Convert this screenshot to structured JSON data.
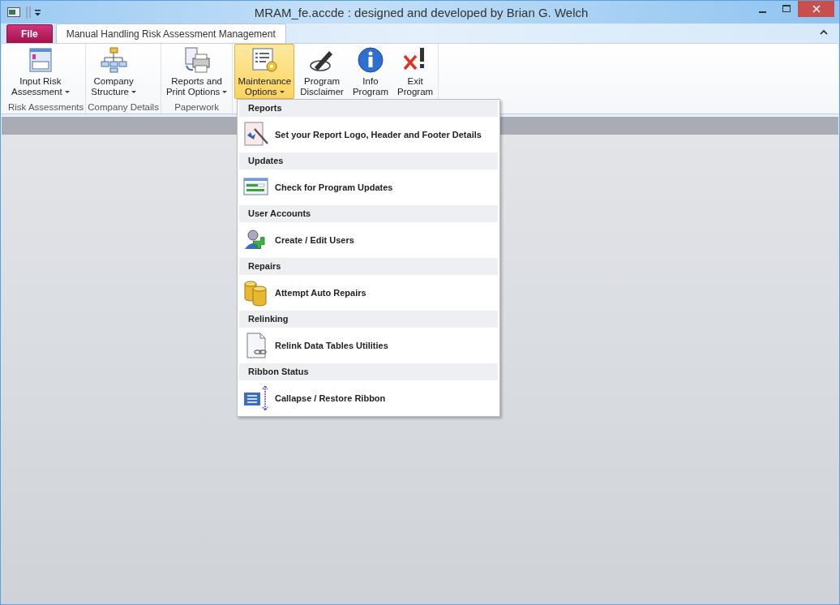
{
  "window": {
    "title": "MRAM_fe.accde : designed and developed by Brian G. Welch"
  },
  "tabs": [
    {
      "label": "File",
      "kind": "file",
      "selected": false
    },
    {
      "label": "Manual Handling Risk Assessment Management",
      "kind": "ribbon",
      "selected": true
    }
  ],
  "ribbon_groups": [
    {
      "label": "Risk Assessments",
      "buttons": [
        {
          "lines": [
            "Input Risk",
            "Assessment"
          ],
          "dropdown": true,
          "selected": false
        }
      ]
    },
    {
      "label": "Company Details",
      "buttons": [
        {
          "lines": [
            "Company",
            "Structure"
          ],
          "dropdown": true,
          "selected": false
        }
      ]
    },
    {
      "label": "Paperwork",
      "buttons": [
        {
          "lines": [
            "Reports and",
            "Print Options"
          ],
          "dropdown": true,
          "selected": false
        }
      ]
    },
    {
      "buttons": [
        {
          "lines": [
            "Maintenance",
            "Options"
          ],
          "dropdown": true,
          "selected": true
        },
        {
          "lines": [
            "Program",
            "Disclaimer"
          ],
          "dropdown": false,
          "selected": false
        },
        {
          "lines": [
            "Info",
            "Program"
          ],
          "dropdown": false,
          "selected": false
        },
        {
          "lines": [
            "Exit",
            "Program"
          ],
          "dropdown": false,
          "selected": false
        }
      ]
    }
  ],
  "menu": [
    {
      "heading": "Reports",
      "item": {
        "label": "Set your Report Logo, Header and Footer Details"
      }
    },
    {
      "heading": "Updates",
      "item": {
        "label": "Check for Program Updates"
      }
    },
    {
      "heading": "User Accounts",
      "item": {
        "label": "Create / Edit Users"
      }
    },
    {
      "heading": "Repairs",
      "item": {
        "label": "Attempt Auto Repairs"
      }
    },
    {
      "heading": "Relinking",
      "item": {
        "label": "Relink Data Tables Utilities"
      }
    },
    {
      "heading": "Ribbon Status",
      "item": {
        "label": "Callapse / Restore Ribbon"
      }
    }
  ]
}
